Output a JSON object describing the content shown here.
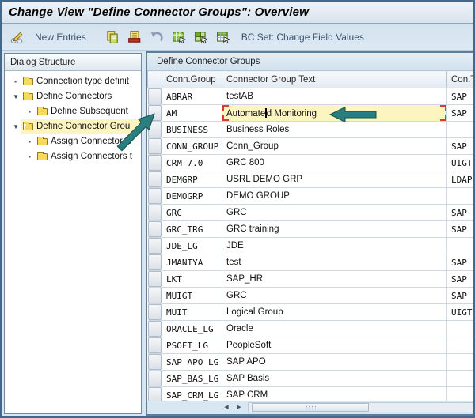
{
  "window": {
    "title": "Change View \"Define Connector Groups\": Overview"
  },
  "toolbar": {
    "new_entries_label": "New Entries",
    "bc_set_label": "BC Set: Change Field Values",
    "icons": [
      "display-change-icon",
      "copy-entries-icon",
      "delete-entry-icon",
      "undo-change-icon",
      "select-all-icon",
      "select-block-icon",
      "deselect-all-icon"
    ]
  },
  "sidebar": {
    "header": "Dialog Structure",
    "items": [
      {
        "marker": "dot",
        "level": 1,
        "folder": "closed",
        "label": "Connection type definit",
        "selected": false
      },
      {
        "marker": "expanded",
        "level": 1,
        "folder": "closed",
        "label": "Define Connectors",
        "selected": false
      },
      {
        "marker": "dot",
        "level": 2,
        "folder": "closed",
        "label": "Define Subsequent",
        "selected": false
      },
      {
        "marker": "expanded",
        "level": 1,
        "folder": "open",
        "label": "Define Connector Grou",
        "selected": true
      },
      {
        "marker": "dot",
        "level": 2,
        "folder": "closed",
        "label": "Assign Connector G",
        "selected": false
      },
      {
        "marker": "dot",
        "level": 2,
        "folder": "closed",
        "label": "Assign Connectors t",
        "selected": false
      }
    ]
  },
  "table": {
    "panel_title": "Define Connector Groups",
    "columns": [
      "Conn.Group",
      "Connector Group Text",
      "Con.Typ"
    ],
    "rows": [
      [
        "ABRAR",
        "testAB",
        "SAP"
      ],
      [
        "AM",
        "Automated Monitoring",
        "SAP"
      ],
      [
        "BUSINESS",
        "Business Roles",
        ""
      ],
      [
        "CONN_GROUP",
        "Conn_Group",
        "SAP"
      ],
      [
        "CRM 7.0",
        "GRC 800",
        "UIGT"
      ],
      [
        "DEMGRP",
        "USRL DEMO GRP",
        "LDAP"
      ],
      [
        "DEMOGRP",
        "DEMO GROUP",
        ""
      ],
      [
        "GRC",
        "GRC",
        "SAP"
      ],
      [
        "GRC_TRG",
        "GRC training",
        "SAP"
      ],
      [
        "JDE_LG",
        "JDE",
        ""
      ],
      [
        "JMANIYA",
        "test",
        "SAP"
      ],
      [
        "LKT",
        "SAP_HR",
        "SAP"
      ],
      [
        "MUIGT",
        "GRC",
        "SAP"
      ],
      [
        "MUIT",
        "Logical Group",
        "UIGT"
      ],
      [
        "ORACLE_LG",
        "Oracle",
        ""
      ],
      [
        "PSOFT_LG",
        "PeopleSoft",
        ""
      ],
      [
        "SAP_APO_LG",
        "SAP APO",
        ""
      ],
      [
        "SAP_BAS_LG",
        "SAP Basis",
        ""
      ],
      [
        "SAP_CRM_LG",
        "SAP CRM",
        ""
      ]
    ],
    "selected_row_index": 1,
    "edit_cell": {
      "text_before_cursor": "Automate",
      "text_after_cursor": "d Monitoring"
    }
  },
  "colors": {
    "annotation_arrow": "#2a7f7e",
    "annotation_arrow_outline": "#14504e",
    "selection_highlight": "#fdf5c0",
    "edit_marker_red": "#e0372e",
    "toolbar_text": "#3c506e"
  }
}
